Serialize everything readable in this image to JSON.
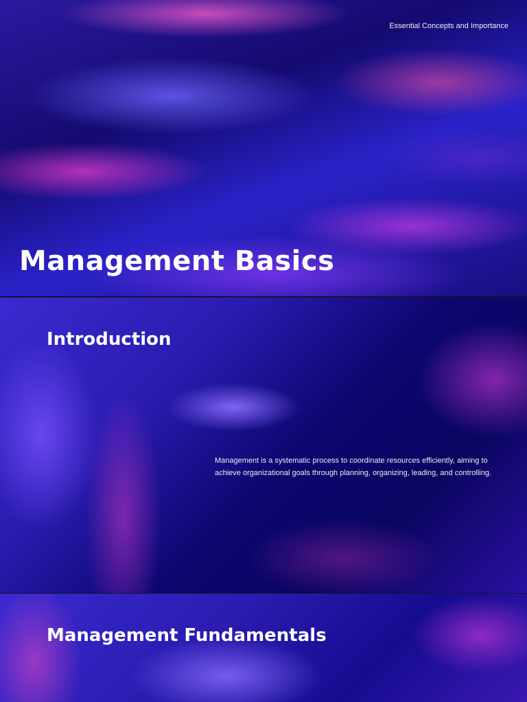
{
  "slides": [
    {
      "title": "Management Basics",
      "subtitle": "Essential Concepts and Importance"
    },
    {
      "title": "Introduction",
      "body": "Management is a systematic process to coordinate resources efficiently, aiming to achieve organizational goals through planning, organizing, leading, and controlling."
    },
    {
      "title": "Management Fundamentals"
    }
  ]
}
